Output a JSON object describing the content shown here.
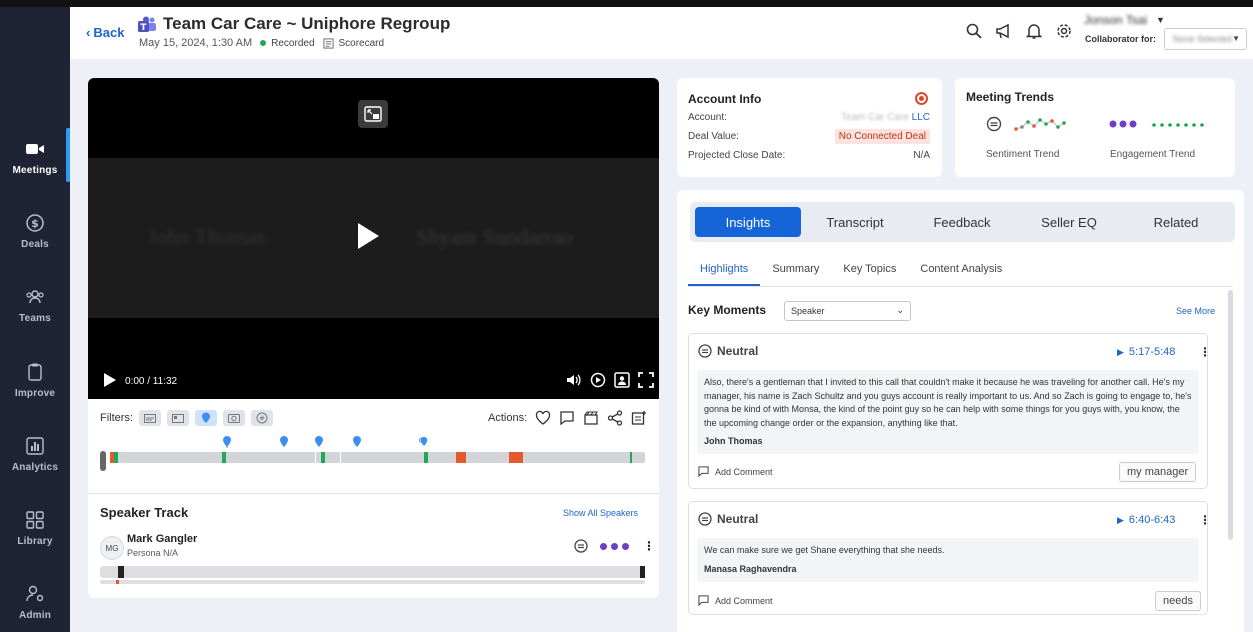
{
  "sidebar": {
    "items": [
      {
        "label": "Meetings",
        "icon": "video-camera-icon",
        "active": true
      },
      {
        "label": "Deals",
        "icon": "dollar-circle-icon",
        "active": false
      },
      {
        "label": "Teams",
        "icon": "people-group-icon",
        "active": false
      },
      {
        "label": "Improve",
        "icon": "clipboard-icon",
        "active": false
      },
      {
        "label": "Analytics",
        "icon": "bar-chart-icon",
        "active": false
      },
      {
        "label": "Library",
        "icon": "grid-icon",
        "active": false
      },
      {
        "label": "Admin",
        "icon": "user-gear-icon",
        "active": false
      }
    ]
  },
  "header": {
    "back_label": "Back",
    "title": "Team Car Care ~ Uniphore Regroup",
    "date": "May 15, 2024, 1:30 AM",
    "recorded_label": "Recorded",
    "scorecard_label": "Scorecard",
    "user_name": "Jonson Tsai",
    "collaborator_label": "Collaborator for:",
    "collaborator_value": "None Selected"
  },
  "video": {
    "time": "0:00 / 11:32",
    "speaker_left": "John Thomas",
    "speaker_right": "Shyam Sundarrao"
  },
  "filters": {
    "label": "Filters:"
  },
  "actions": {
    "label": "Actions:"
  },
  "speaker_track": {
    "title": "Speaker Track",
    "show_all": "Show All Speakers",
    "speaker": {
      "initials": "MG",
      "name": "Mark Gangler",
      "persona": "Persona N/A"
    }
  },
  "account_info": {
    "title": "Account Info",
    "account_label": "Account:",
    "account_value": "Team Car Care LLC",
    "deal_value_label": "Deal Value:",
    "deal_value": "No Connected Deal",
    "close_date_label": "Projected Close Date:",
    "close_date_value": "N/A"
  },
  "meeting_trends": {
    "title": "Meeting Trends",
    "sentiment_label": "Sentiment Trend",
    "engagement_label": "Engagement Trend"
  },
  "insights": {
    "tabs": [
      "Insights",
      "Transcript",
      "Feedback",
      "Seller EQ",
      "Related"
    ],
    "subtabs": [
      "Highlights",
      "Summary",
      "Key Topics",
      "Content Analysis"
    ],
    "key_moments_title": "Key Moments",
    "filter_value": "Speaker",
    "see_more": "See More",
    "moments": [
      {
        "sentiment": "Neutral",
        "time": "5:17-5:48",
        "text": "Also, there's a gentleman that I invited to this call that couldn't make it because he was traveling for another call. He's my manager, his name is Zach Schultz and you guys account is really important to us. And so Zach is going to engage to, he's gonna be kind of with Monsa, the kind of the point guy so he can help with some things for you guys with, you know, the the upcoming change order or the expansion, anything like that.",
        "speaker": "John Thomas",
        "comment_label": "Add Comment",
        "tag": "my manager"
      },
      {
        "sentiment": "Neutral",
        "time": "6:40-6:43",
        "text": "We can make sure we get Shane everything that she needs.",
        "speaker": "Manasa Raghavendra",
        "comment_label": "Add Comment",
        "tag": "needs"
      }
    ]
  }
}
